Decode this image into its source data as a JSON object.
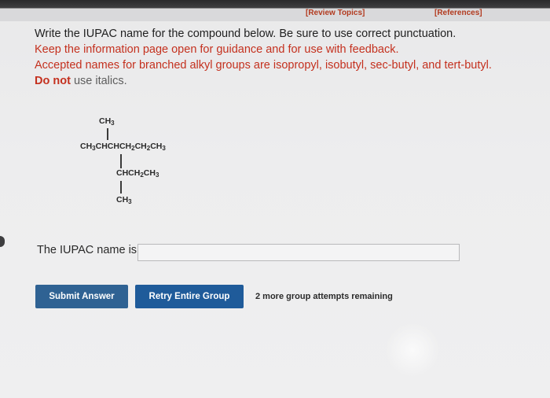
{
  "header": {
    "review_topics": "[Review Topics]",
    "references": "[References]"
  },
  "instructions": {
    "line1": "Write the IUPAC name for the compound below. Be sure to use correct punctuation.",
    "line2": "Keep the information page open for guidance and for use with feedback.",
    "line3": "Accepted names for branched alkyl groups are isopropyl, isobutyl, sec-butyl, and tert-butyl.",
    "line4_bold": "Do not",
    "line4_rest": "use italics."
  },
  "structure": {
    "top_methyl": "CH3",
    "main_chain": "CH3CHCHCH2CH2CH3",
    "branch": "CHCH2CH3",
    "bottom_methyl": "CH3"
  },
  "answer": {
    "label": "The IUPAC name is",
    "value": "",
    "placeholder": ""
  },
  "buttons": {
    "submit": "Submit Answer",
    "retry": "Retry Entire Group"
  },
  "status": {
    "attempts": "2 more group attempts remaining"
  }
}
